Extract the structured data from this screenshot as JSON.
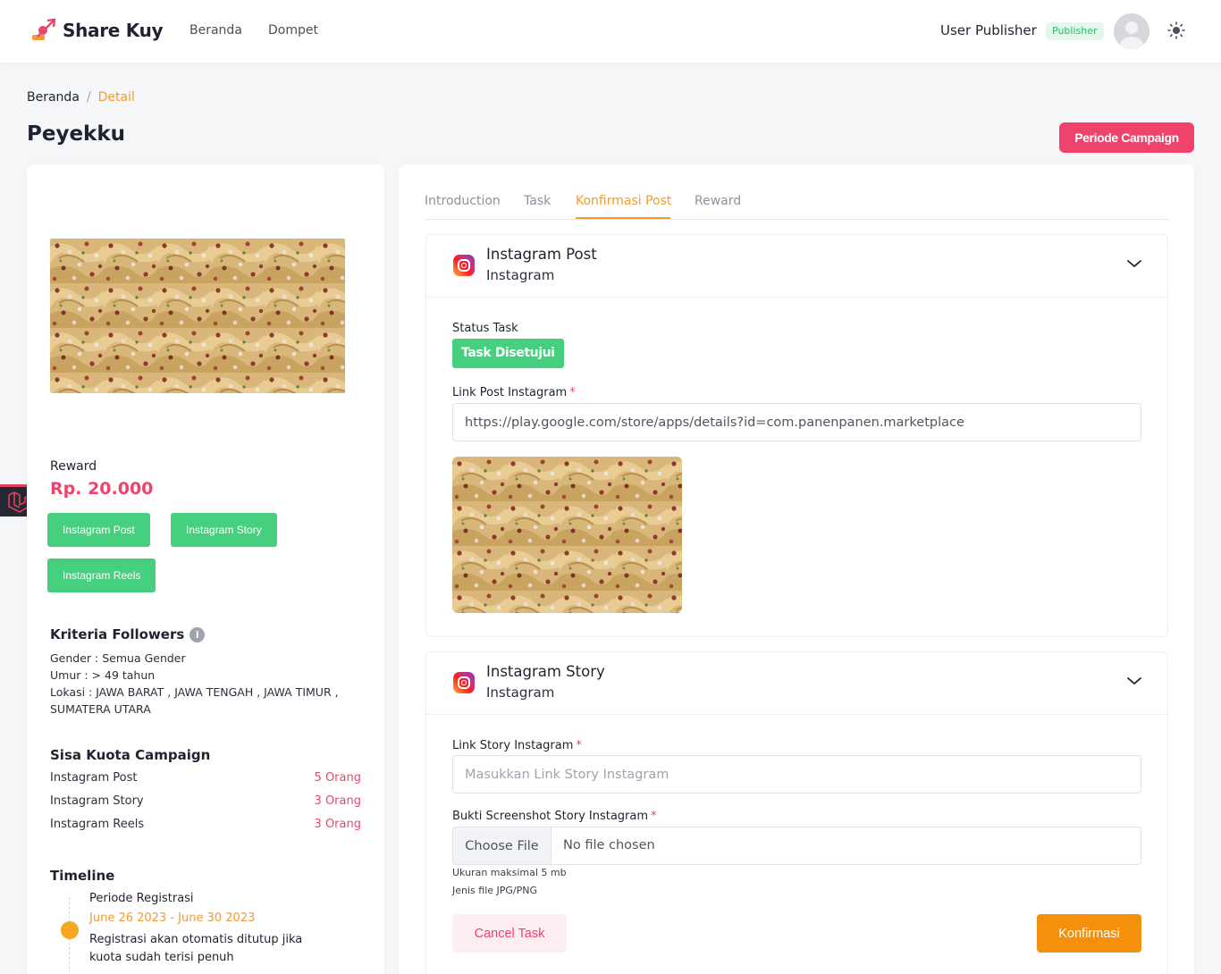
{
  "header": {
    "brand": "Share Kuy",
    "nav": [
      "Beranda",
      "Dompet"
    ],
    "user_name": "User Publisher",
    "role": "Publisher"
  },
  "breadcrumb": {
    "home": "Beranda",
    "separator": "/",
    "current": "Detail"
  },
  "page": {
    "title": "Peyekku",
    "periode_button": "Periode Campaign"
  },
  "left": {
    "reward_label": "Reward",
    "reward_value": "Rp. 20.000",
    "platform_tags": [
      "Instagram Post",
      "Instagram Story",
      "Instagram Reels"
    ],
    "criteria_title": "Kriteria Followers",
    "criteria": [
      "Gender : Semua Gender",
      "Umur : > 49 tahun",
      "Lokasi : JAWA BARAT , JAWA TENGAH , JAWA TIMUR , SUMATERA UTARA"
    ],
    "quota_title": "Sisa Kuota Campaign",
    "quota": [
      {
        "label": "Instagram Post",
        "value": "5 Orang"
      },
      {
        "label": "Instagram Story",
        "value": "3 Orang"
      },
      {
        "label": "Instagram Reels",
        "value": "3 Orang"
      }
    ],
    "timeline_title": "Timeline",
    "timeline": {
      "title": "Periode Registrasi",
      "date": "June 26 2023 - June 30 2023",
      "desc": "Registrasi akan otomatis ditutup jika kuota sudah terisi penuh"
    }
  },
  "tabs": [
    "Introduction",
    "Task",
    "Konfirmasi Post",
    "Reward"
  ],
  "active_tab": "Konfirmasi Post",
  "post_panel": {
    "title": "Instagram Post",
    "subtitle": "Instagram",
    "status_label": "Status Task",
    "status_value": "Task Disetujui",
    "link_label": "Link Post Instagram",
    "required_mark": "*",
    "link_value": "https://play.google.com/store/apps/details?id=com.panenpanen.marketplace"
  },
  "story_panel": {
    "title": "Instagram Story",
    "subtitle": "Instagram",
    "link_label": "Link Story Instagram",
    "required_mark": "*",
    "link_placeholder": "Masukkan Link Story Instagram",
    "screenshot_label": "Bukti Screenshot Story Instagram",
    "file_button": "Choose File",
    "file_status": "No file chosen",
    "hint_size": "Ukuran maksimal 5 mb",
    "hint_type": "Jenis file JPG/PNG",
    "cancel_button": "Cancel Task",
    "confirm_button": "Konfirmasi"
  },
  "icons": {
    "logo": "share-kuy-logo-icon",
    "theme": "sun-icon",
    "avatar": "user-avatar-icon",
    "info": "info-icon",
    "chevron": "chevron-down-icon",
    "instagram": "instagram-icon",
    "side": "laravel-icon"
  },
  "colors": {
    "accent_orange": "#f39a31",
    "accent_pink": "#f0436c",
    "success_green": "#46cf7f",
    "confirm_orange": "#f4900c"
  }
}
